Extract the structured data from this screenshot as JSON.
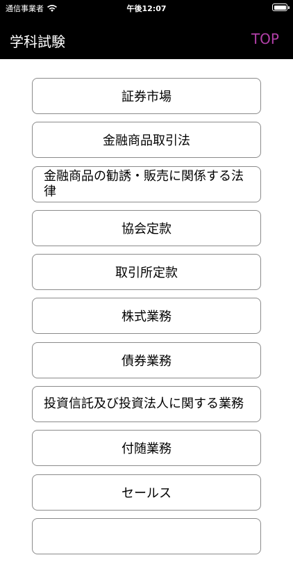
{
  "status_bar": {
    "carrier": "通信事業者",
    "time": "午後12:07",
    "wifi_icon": "wifi-icon",
    "battery_icon": "battery-icon"
  },
  "nav": {
    "title": "学科試験",
    "top_button": "TOP"
  },
  "colors": {
    "header_bg": "#000000",
    "top_accent": "#b23fa8",
    "button_border": "#8a8a8a"
  },
  "menu": [
    {
      "label": "証券市場"
    },
    {
      "label": "金融商品取引法"
    },
    {
      "label": "金融商品の勧誘・販売に関係する法律"
    },
    {
      "label": "協会定款"
    },
    {
      "label": "取引所定款"
    },
    {
      "label": "株式業務"
    },
    {
      "label": "債券業務"
    },
    {
      "label": "投資信託及び投資法人に関する業務"
    },
    {
      "label": "付随業務"
    },
    {
      "label": "セールス"
    },
    {
      "label": ""
    }
  ]
}
